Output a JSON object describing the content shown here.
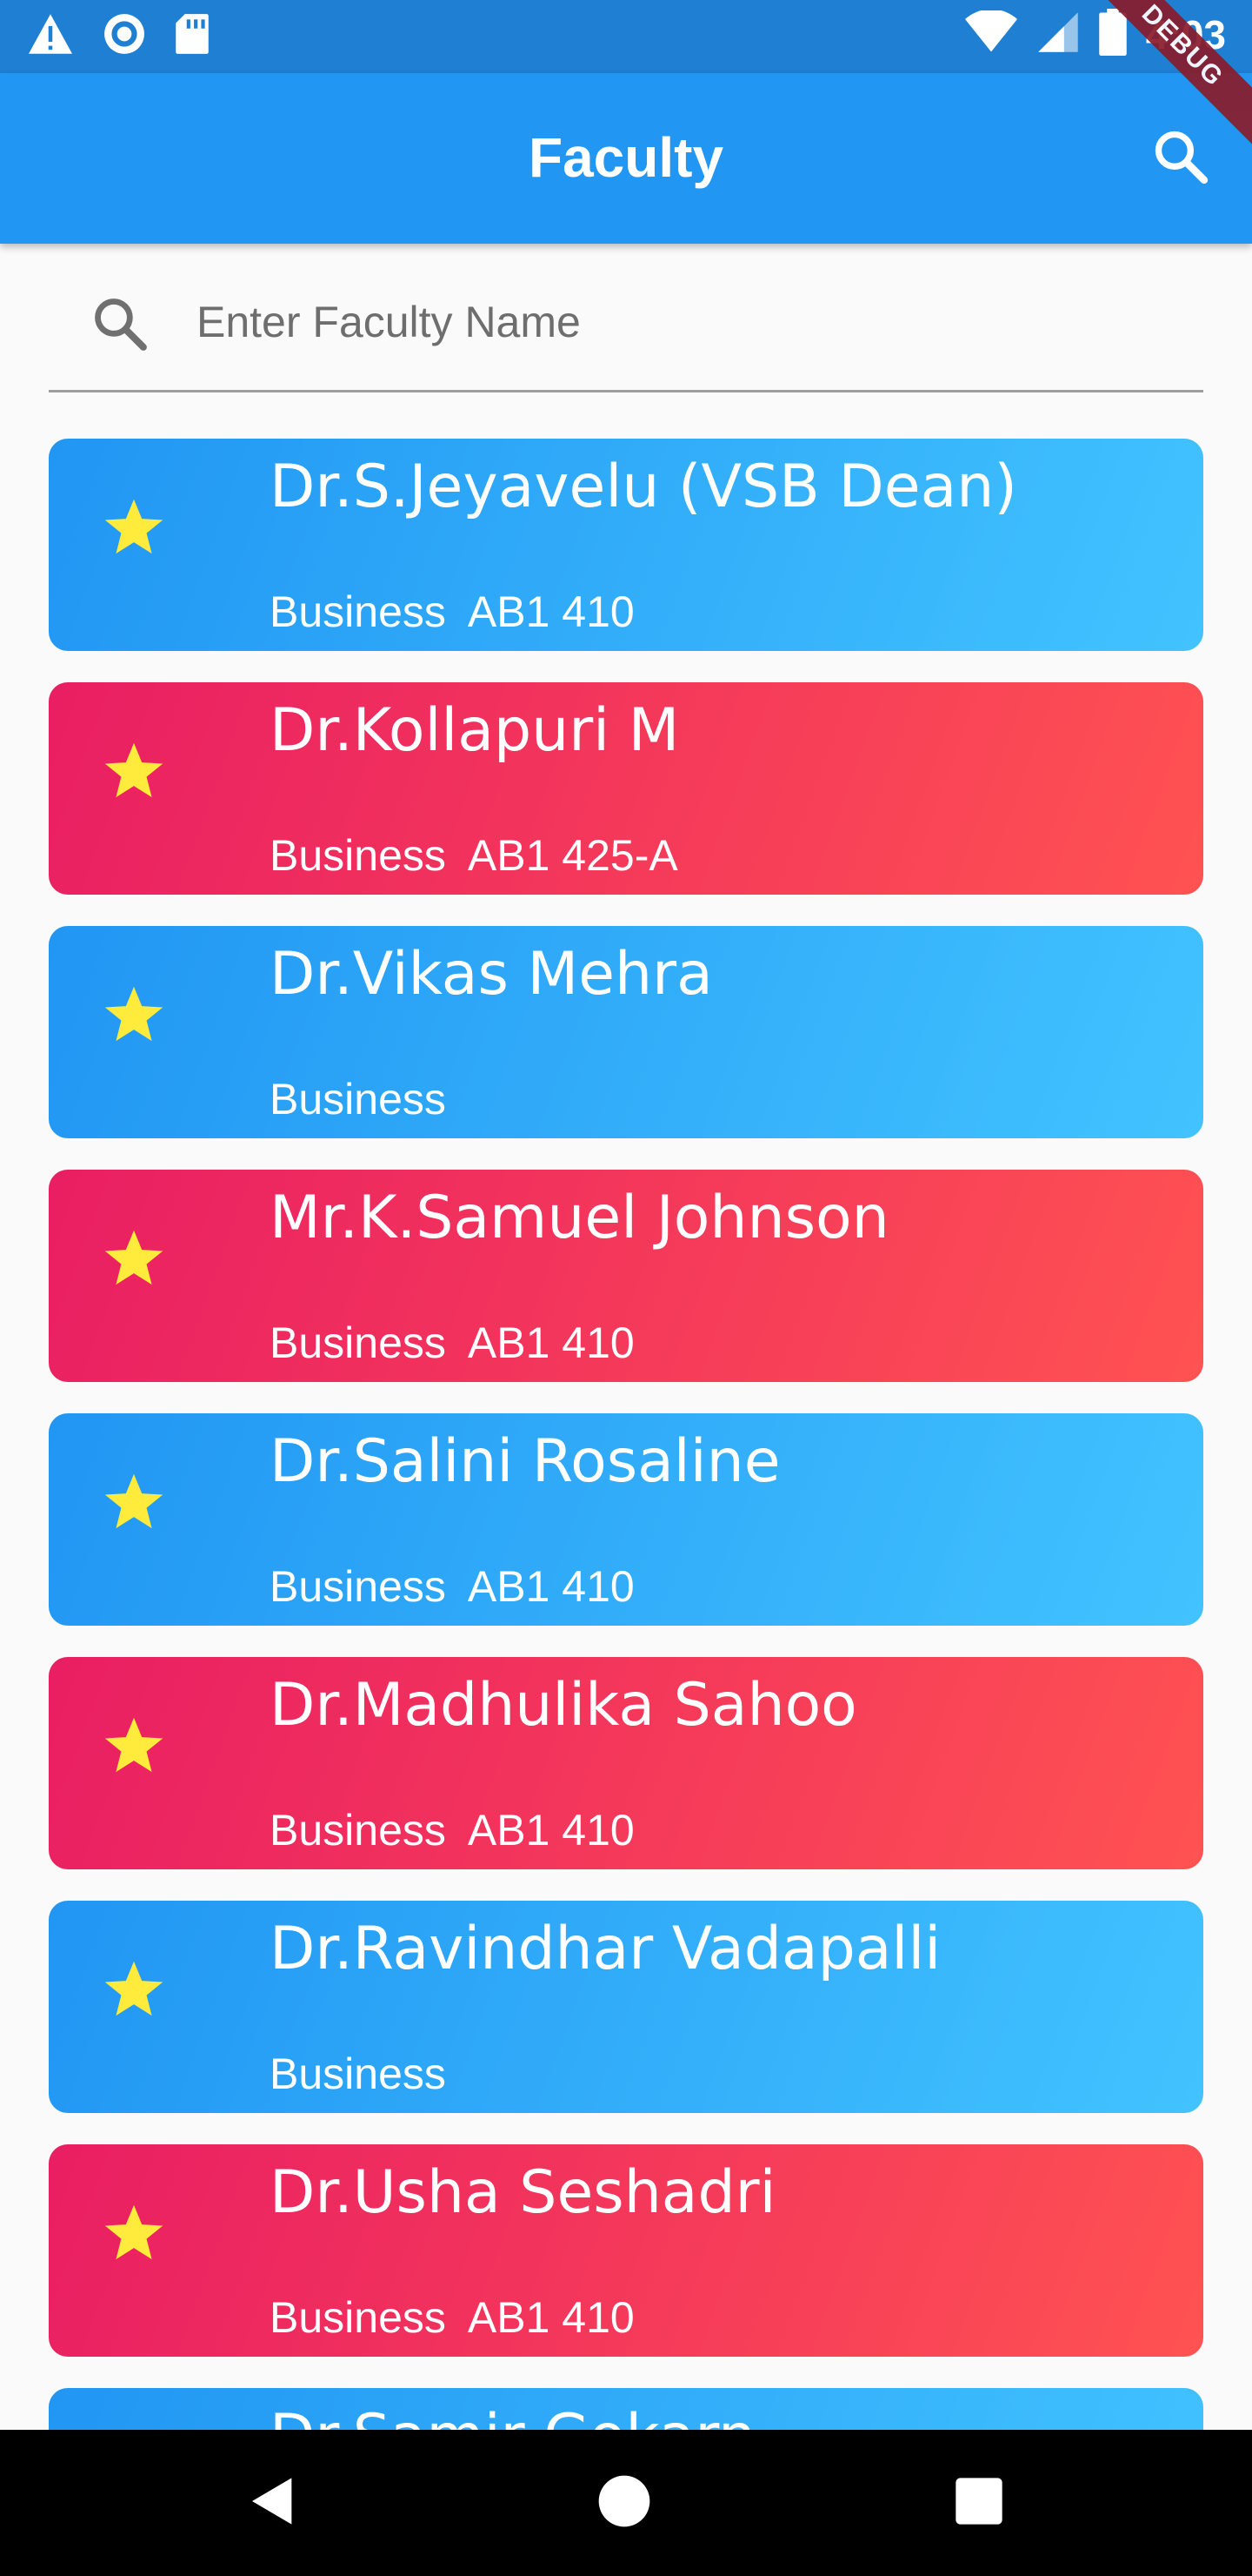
{
  "status_bar": {
    "time": "4:03",
    "left_icons": [
      "warning-icon",
      "record-icon",
      "sd-card-icon"
    ],
    "right_icons": [
      "wifi-icon",
      "signal-icon",
      "battery-icon"
    ]
  },
  "debug_banner": "DEBUG",
  "app_bar": {
    "title": "Faculty",
    "background": "#2196f3"
  },
  "search": {
    "placeholder": "Enter Faculty Name",
    "value": ""
  },
  "faculty": [
    {
      "name": "Dr.S.Jeyavelu (VSB Dean)",
      "subtitle": "Business  AB1 410",
      "color": "blue"
    },
    {
      "name": "Dr.Kollapuri M",
      "subtitle": "Business  AB1 425-A",
      "color": "red"
    },
    {
      "name": "Dr.Vikas Mehra",
      "subtitle": "Business",
      "color": "blue"
    },
    {
      "name": "Mr.K.Samuel Johnson",
      "subtitle": "Business  AB1 410",
      "color": "red"
    },
    {
      "name": "Dr.Salini Rosaline",
      "subtitle": "Business  AB1 410",
      "color": "blue"
    },
    {
      "name": "Dr.Madhulika Sahoo",
      "subtitle": "Business  AB1 410",
      "color": "red"
    },
    {
      "name": "Dr.Ravindhar Vadapalli",
      "subtitle": "Business",
      "color": "blue"
    },
    {
      "name": "Dr.Usha Seshadri",
      "subtitle": "Business  AB1 410",
      "color": "red"
    },
    {
      "name": "Dr.Samir Gokarn",
      "subtitle": "",
      "color": "blue"
    }
  ],
  "colors": {
    "card_blue": "#2196f3",
    "card_red": "#e91e63",
    "star": "#ffeb3b"
  },
  "nav_bar": [
    "back-icon",
    "home-icon",
    "recents-icon"
  ]
}
